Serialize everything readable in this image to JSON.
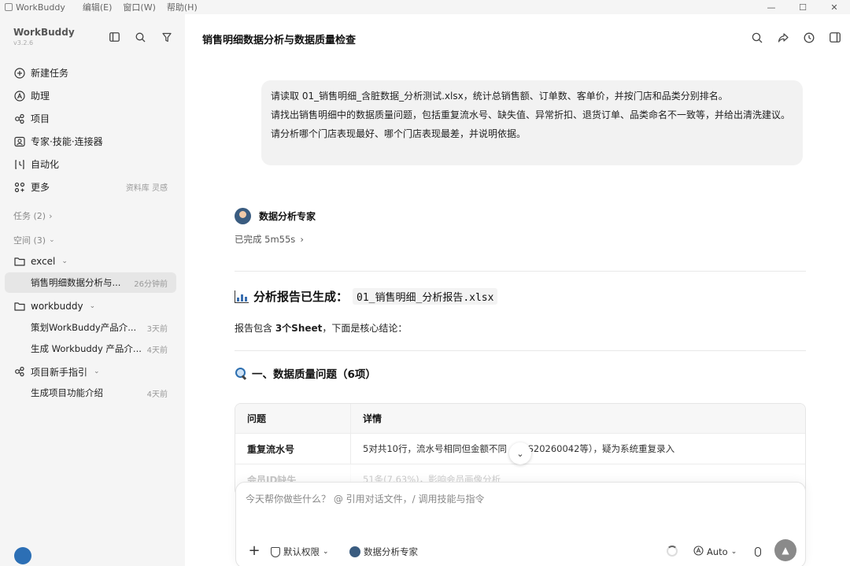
{
  "titlebar": {
    "app": "WorkBuddy",
    "menus": [
      "编辑(E)",
      "窗口(W)",
      "帮助(H)"
    ],
    "controls": [
      "—",
      "☐",
      "✕"
    ]
  },
  "sidebar": {
    "brand": "WorkBuddy",
    "version": "v3.2.6",
    "nav": [
      {
        "label": "新建任务",
        "icon": "new-task-icon"
      },
      {
        "label": "助理",
        "icon": "assistant-icon"
      },
      {
        "label": "项目",
        "icon": "project-icon"
      },
      {
        "label": "专家·技能·连接器",
        "icon": "expert-icon"
      },
      {
        "label": "自动化",
        "icon": "automation-icon"
      },
      {
        "label": "更多",
        "icon": "more-icon",
        "extra": "资料库 灵感"
      }
    ],
    "tasks_section": "任务 (2)",
    "spaces_section": "空间 (3)",
    "folders": [
      {
        "name": "excel",
        "tasks": [
          {
            "title": "销售明细数据分析与...",
            "time": "26分钟前",
            "active": true
          }
        ]
      },
      {
        "name": "workbuddy",
        "tasks": [
          {
            "title": "策划WorkBuddy产品介...",
            "time": "3天前"
          },
          {
            "title": "生成 Workbuddy 产品介...",
            "time": "4天前"
          }
        ]
      },
      {
        "name": "项目新手指引",
        "tasks": [
          {
            "title": "生成项目功能介绍",
            "time": "4天前"
          }
        ]
      }
    ]
  },
  "main": {
    "title": "销售明细数据分析与数据质量检查",
    "user_message": [
      "请读取 01_销售明细_含脏数据_分析测试.xlsx，统计总销售额、订单数、客单价，并按门店和品类分别排名。",
      "请找出销售明细中的数据质量问题，包括重复流水号、缺失值、异常折扣、退货订单、品类命名不一致等，并给出清洗建议。",
      "请分析哪个门店表现最好、哪个门店表现最差，并说明依据。"
    ],
    "agent_name": "数据分析专家",
    "status": "已完成 5m55s",
    "report_title_prefix": "分析报告已生成：",
    "report_file": "01_销售明细_分析报告.xlsx",
    "report_summary_a": "报告包含 ",
    "report_summary_b": "3个Sheet",
    "report_summary_c": "，下面是核心结论：",
    "section_title": "一、数据质量问题（6项）",
    "table": {
      "headers": [
        "问题",
        "详情"
      ],
      "rows": [
        [
          "重复流水号",
          "5对共10行，流水号相同但金额不同（如 S20260042等），疑为系统重复录入"
        ],
        [
          "会员ID缺失",
          "51条(7.63%)，影响会员画像分析"
        ]
      ]
    }
  },
  "composer": {
    "placeholder": "今天帮你做些什么？ @ 引用对话文件，/ 调用技能与指令",
    "permission": "默认权限",
    "agent": "数据分析专家",
    "mode": "Auto"
  }
}
